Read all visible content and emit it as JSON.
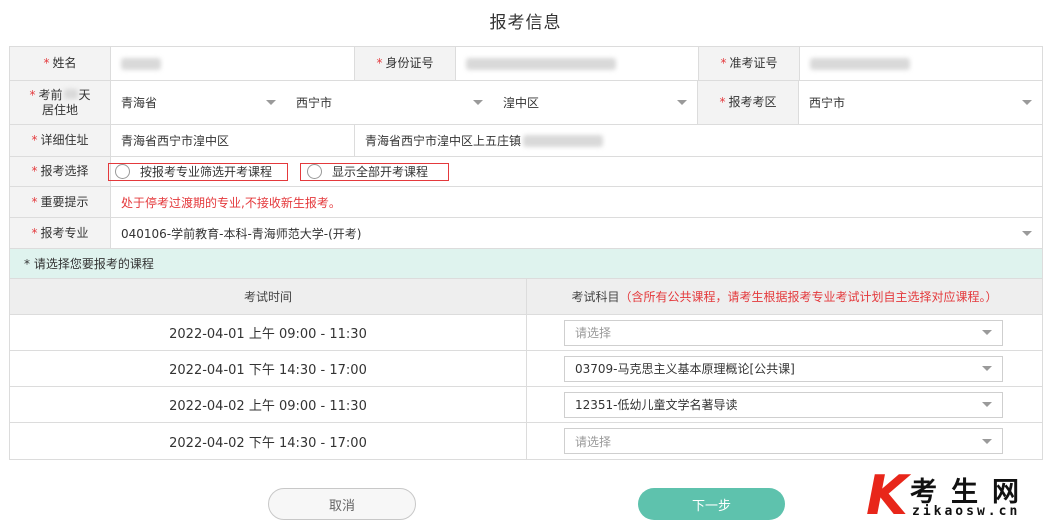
{
  "page": {
    "title": "报考信息"
  },
  "form": {
    "star": "*",
    "name": {
      "label": "姓名"
    },
    "id_card": {
      "label": "身份证号"
    },
    "admission_no": {
      "label": "准考证号"
    },
    "residence": {
      "label_line1": "考前",
      "label_line1b": "天",
      "label_line2": "居住地",
      "province": "青海省",
      "city": "西宁市",
      "district": "湟中区"
    },
    "exam_area": {
      "label": "报考考区",
      "value": "西宁市"
    },
    "address": {
      "label": "详细住址",
      "prefix": "青海省西宁市湟中区",
      "value": "青海省西宁市湟中区上五庄镇"
    },
    "choice": {
      "label": "报考选择",
      "option1": "按报考专业筛选开考课程",
      "option2": "显示全部开考课程"
    },
    "notice": {
      "label": "重要提示",
      "text": "处于停考过渡期的专业,不接收新生报考。"
    },
    "major": {
      "label": "报考专业",
      "value": "040106-学前教育-本科-青海师范大学-(开考)"
    }
  },
  "courses": {
    "section_title": "* 请选择您要报考的课程",
    "col_time": "考试时间",
    "col_subject": "考试科目",
    "col_subject_note": "（含所有公共课程，请考生根据报考专业考试计划自主选择对应课程。）",
    "rows": [
      {
        "time": "2022-04-01 上午 09:00 - 11:30",
        "subject": "请选择",
        "placeholder": true
      },
      {
        "time": "2022-04-01 下午 14:30 - 17:00",
        "subject": "03709-马克思主义基本原理概论[公共课]",
        "placeholder": false
      },
      {
        "time": "2022-04-02 上午 09:00 - 11:30",
        "subject": "12351-低幼儿童文学名著导读",
        "placeholder": false
      },
      {
        "time": "2022-04-02 下午 14:30 - 17:00",
        "subject": "请选择",
        "placeholder": true
      }
    ]
  },
  "buttons": {
    "cancel": "取消",
    "next": "下一步"
  },
  "watermark": {
    "letter": "K",
    "cn": "考生网",
    "en": "zikaosw.cn"
  },
  "colors": {
    "accent": "#5ec2ad",
    "required": "#e4393c",
    "section_bg": "#dff3ee"
  }
}
